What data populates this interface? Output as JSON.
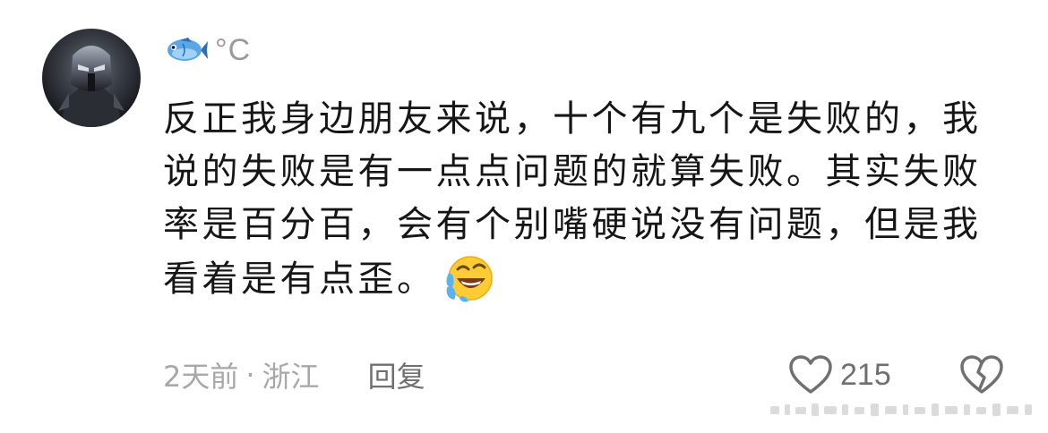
{
  "comment": {
    "username": "°C",
    "avatar_icon": "armored-figure-avatar",
    "username_icon": "fish-icon",
    "lines": [
      "反正我身边朋友来说，十个有九个是失败的，我",
      "说的失败是有一点点问题的就算失败。其实失败",
      "率是百分百，会有个别嘴硬说没有问题，但是我",
      "看着是有点歪。"
    ],
    "trailing_emoji": "laughing-crying-emoji",
    "time": "2天前",
    "separator": "·",
    "location": "浙江",
    "reply_label": "回复",
    "like_count": "215",
    "like_icon": "heart-outline-icon",
    "dislike_icon": "broken-heart-icon"
  }
}
